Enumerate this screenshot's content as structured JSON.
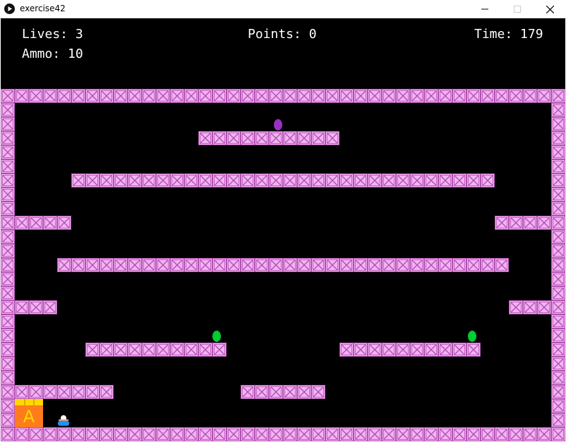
{
  "window": {
    "title": "exercise42",
    "icon": "play-icon",
    "controls": [
      "minimize-icon",
      "maximize-icon",
      "close-icon"
    ]
  },
  "hud": {
    "lives": "Lives: 3",
    "points": "Points: 0",
    "time": "Time: 179",
    "ammo": "Ammo: 10"
  },
  "colors": {
    "background": "#000000",
    "crate": "#f3b3f3",
    "crate_frame": "#b050b0",
    "pickup_purple": "#9a30c0",
    "pickup_green": "#00cc33",
    "ammo_box": "#ff7b1c",
    "ammo_lid": "#ffd800",
    "player": "#1e90ff"
  },
  "ammo_box": {
    "letter": "A"
  }
}
